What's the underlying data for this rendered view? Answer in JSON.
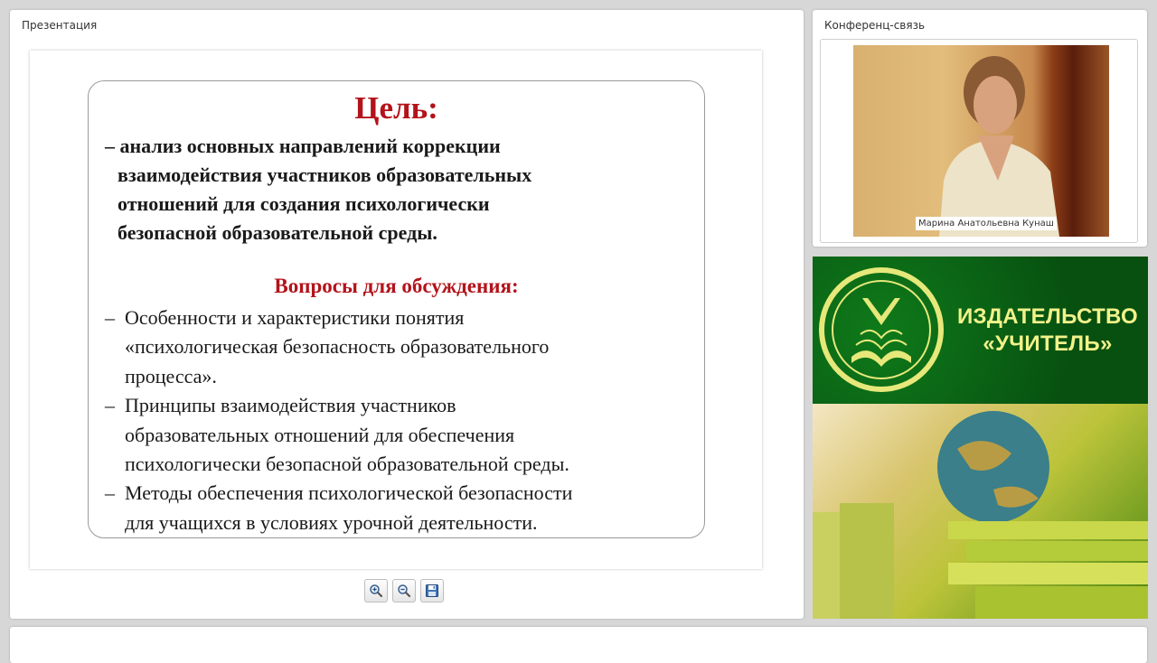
{
  "presentation": {
    "title": "Презентация",
    "slide": {
      "heading": "Цель:",
      "goal_lines": [
        "– анализ основных направлений коррекции",
        "взаимодействия участников образовательных",
        "отношений для создания психологически",
        "безопасной образовательной среды."
      ],
      "questions_title": "Вопросы для обсуждения:",
      "questions": [
        [
          "Особенности и характеристики понятия",
          "«психологическая безопасность образовательного",
          "процесса»."
        ],
        [
          "Принципы взаимодействия участников",
          "образовательных отношений  для обеспечения",
          "психологически безопасной образовательной среды."
        ],
        [
          "Методы обеспечения психологической безопасности",
          "для учащихся в условиях урочной деятельности."
        ]
      ],
      "dash": "–"
    },
    "toolbar": {
      "zoom_in_icon": "zoom-in-icon",
      "zoom_out_icon": "zoom-out-icon",
      "save_icon": "floppy-disk-icon"
    }
  },
  "conference": {
    "title": "Конференц-связь",
    "speaker_name": "Марина Анатольевна Кунаш"
  },
  "banner": {
    "line1": "ИЗДАТЕЛЬСТВО",
    "line2": "«УЧИТЕЛЬ»",
    "logo_icon": "publisher-logo-icon",
    "colors": {
      "green": "#075010",
      "text": "#f2f28a"
    }
  }
}
